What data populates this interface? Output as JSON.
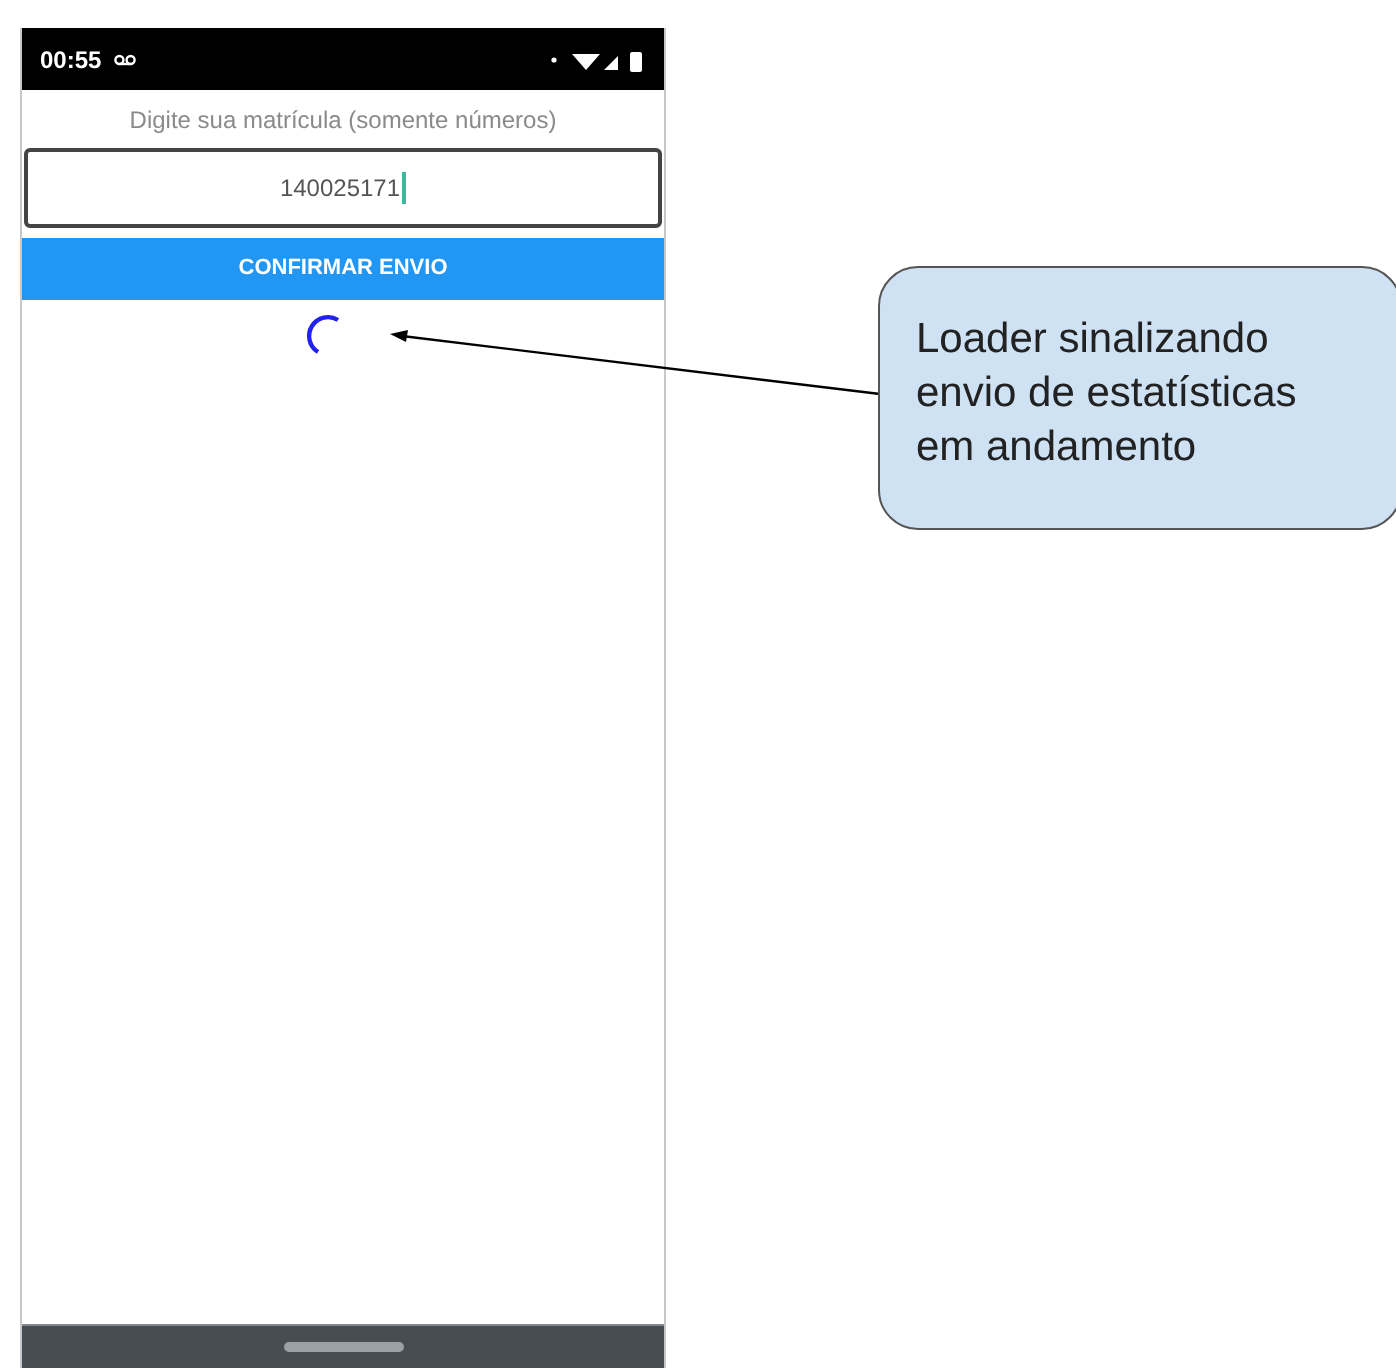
{
  "status_bar": {
    "time": "00:55"
  },
  "form": {
    "label": "Digite sua matrícula (somente números)",
    "value": "140025171",
    "button": "CONFIRMAR ENVIO",
    "loading": true
  },
  "callout": {
    "text": "Loader sinalizando envio de estatísticas em andamento"
  }
}
